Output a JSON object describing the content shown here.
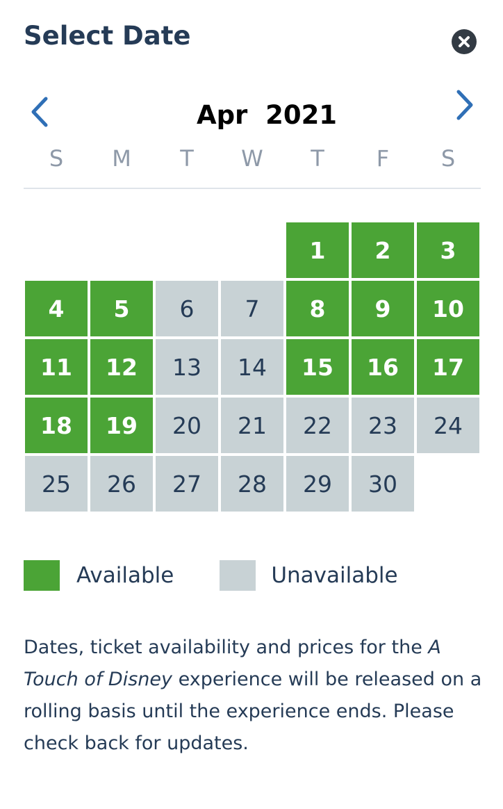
{
  "header": {
    "title": "Select Date",
    "close_icon": "close-icon"
  },
  "calendar": {
    "month": "Apr",
    "year": "2021",
    "prev_icon": "chevron-left-icon",
    "next_icon": "chevron-right-icon",
    "weekdays": [
      "S",
      "M",
      "T",
      "W",
      "T",
      "F",
      "S"
    ],
    "leading_blank_days": 4,
    "days": [
      {
        "day": "1",
        "status": "available"
      },
      {
        "day": "2",
        "status": "available"
      },
      {
        "day": "3",
        "status": "available"
      },
      {
        "day": "4",
        "status": "available"
      },
      {
        "day": "5",
        "status": "available"
      },
      {
        "day": "6",
        "status": "unavailable"
      },
      {
        "day": "7",
        "status": "unavailable"
      },
      {
        "day": "8",
        "status": "available"
      },
      {
        "day": "9",
        "status": "available"
      },
      {
        "day": "10",
        "status": "available"
      },
      {
        "day": "11",
        "status": "available"
      },
      {
        "day": "12",
        "status": "available"
      },
      {
        "day": "13",
        "status": "unavailable"
      },
      {
        "day": "14",
        "status": "unavailable"
      },
      {
        "day": "15",
        "status": "available"
      },
      {
        "day": "16",
        "status": "available"
      },
      {
        "day": "17",
        "status": "available"
      },
      {
        "day": "18",
        "status": "available"
      },
      {
        "day": "19",
        "status": "available"
      },
      {
        "day": "20",
        "status": "unavailable"
      },
      {
        "day": "21",
        "status": "unavailable"
      },
      {
        "day": "22",
        "status": "unavailable"
      },
      {
        "day": "23",
        "status": "unavailable"
      },
      {
        "day": "24",
        "status": "unavailable"
      },
      {
        "day": "25",
        "status": "unavailable"
      },
      {
        "day": "26",
        "status": "unavailable"
      },
      {
        "day": "27",
        "status": "unavailable"
      },
      {
        "day": "28",
        "status": "unavailable"
      },
      {
        "day": "29",
        "status": "unavailable"
      },
      {
        "day": "30",
        "status": "unavailable"
      }
    ]
  },
  "legend": {
    "available_label": "Available",
    "unavailable_label": "Unavailable"
  },
  "colors": {
    "available": "#4ba436",
    "unavailable": "#c8d2d5",
    "text_primary": "#253b56",
    "accent": "#2f6fb6"
  },
  "note": {
    "part1": "Dates, ticket availability and prices for the ",
    "experience_name": "A Touch of Disney",
    "part2": " experience will be released on a rolling basis until the experience ends. Please check back for updates."
  }
}
